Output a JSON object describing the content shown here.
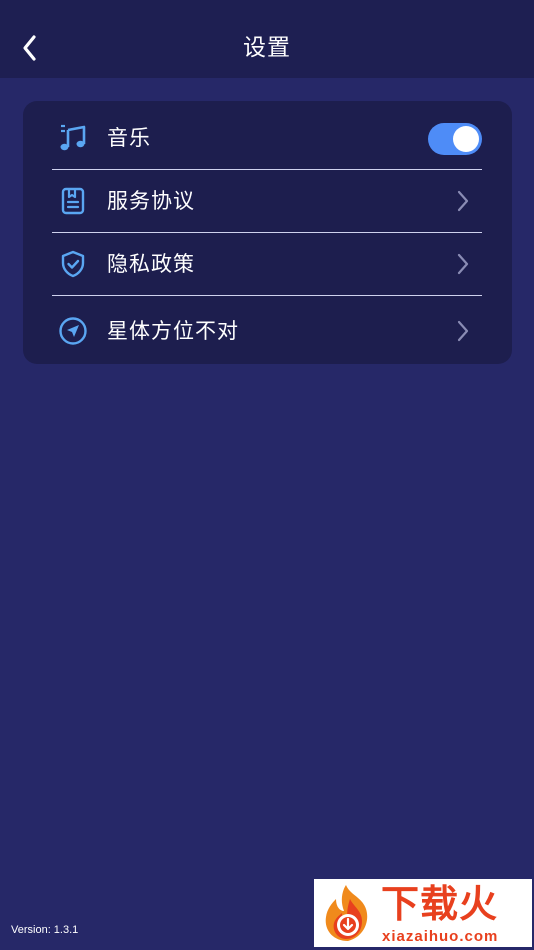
{
  "header": {
    "title": "设置",
    "back_icon": "chevron-left-icon"
  },
  "settings": {
    "items": [
      {
        "label": "音乐",
        "icon": "music-note-icon",
        "control": "toggle",
        "enabled": true
      },
      {
        "label": "服务协议",
        "icon": "document-icon",
        "control": "chevron"
      },
      {
        "label": "隐私政策",
        "icon": "shield-check-icon",
        "control": "chevron"
      },
      {
        "label": "星体方位不对",
        "icon": "navigation-arrow-icon",
        "control": "chevron"
      }
    ]
  },
  "footer": {
    "version": "Version: 1.3.1"
  },
  "watermark": {
    "main": "下载火",
    "sub": "xiazaihuo.com"
  },
  "colors": {
    "background": "#262868",
    "header_background": "#1e1f52",
    "card_background": "#1d1e4e",
    "accent": "#4e8cf7",
    "icon_accent": "#5aa6f2",
    "watermark_red": "#e8401e"
  }
}
